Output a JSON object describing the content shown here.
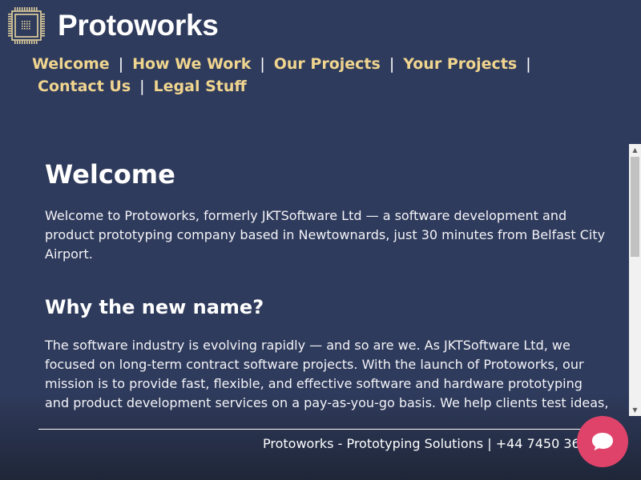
{
  "brand": {
    "name": "Protoworks",
    "logo_icon": "chip-icon"
  },
  "nav": {
    "items": [
      {
        "label": "Welcome"
      },
      {
        "label": "How We Work"
      },
      {
        "label": "Our Projects"
      },
      {
        "label": "Your Projects"
      },
      {
        "label": "Contact Us"
      },
      {
        "label": "Legal Stuff"
      }
    ],
    "separator": "|"
  },
  "content": {
    "heading": "Welcome",
    "intro": "Welcome to Protoworks, formerly JKTSoftware Ltd — a software development and product prototyping company based in Newtownards, just 30 minutes from Belfast City Airport.",
    "subheading": "Why the new name?",
    "body": "The software industry is evolving rapidly — and so are we. As JKTSoftware Ltd, we focused on long-term contract software projects. With the launch of Protoworks, our mission is to provide fast, flexible, and effective software and hardware prototyping and product development services on a pay-as-you-go basis. We help clients test ideas,"
  },
  "footer": {
    "text": "Protoworks - Prototyping Solutions | +44 7450 36"
  },
  "chat": {
    "icon": "chat-bubble-icon"
  },
  "colors": {
    "background": "#2f3b5c",
    "nav_link": "#f0d58f",
    "chat_button": "#e0436a"
  }
}
